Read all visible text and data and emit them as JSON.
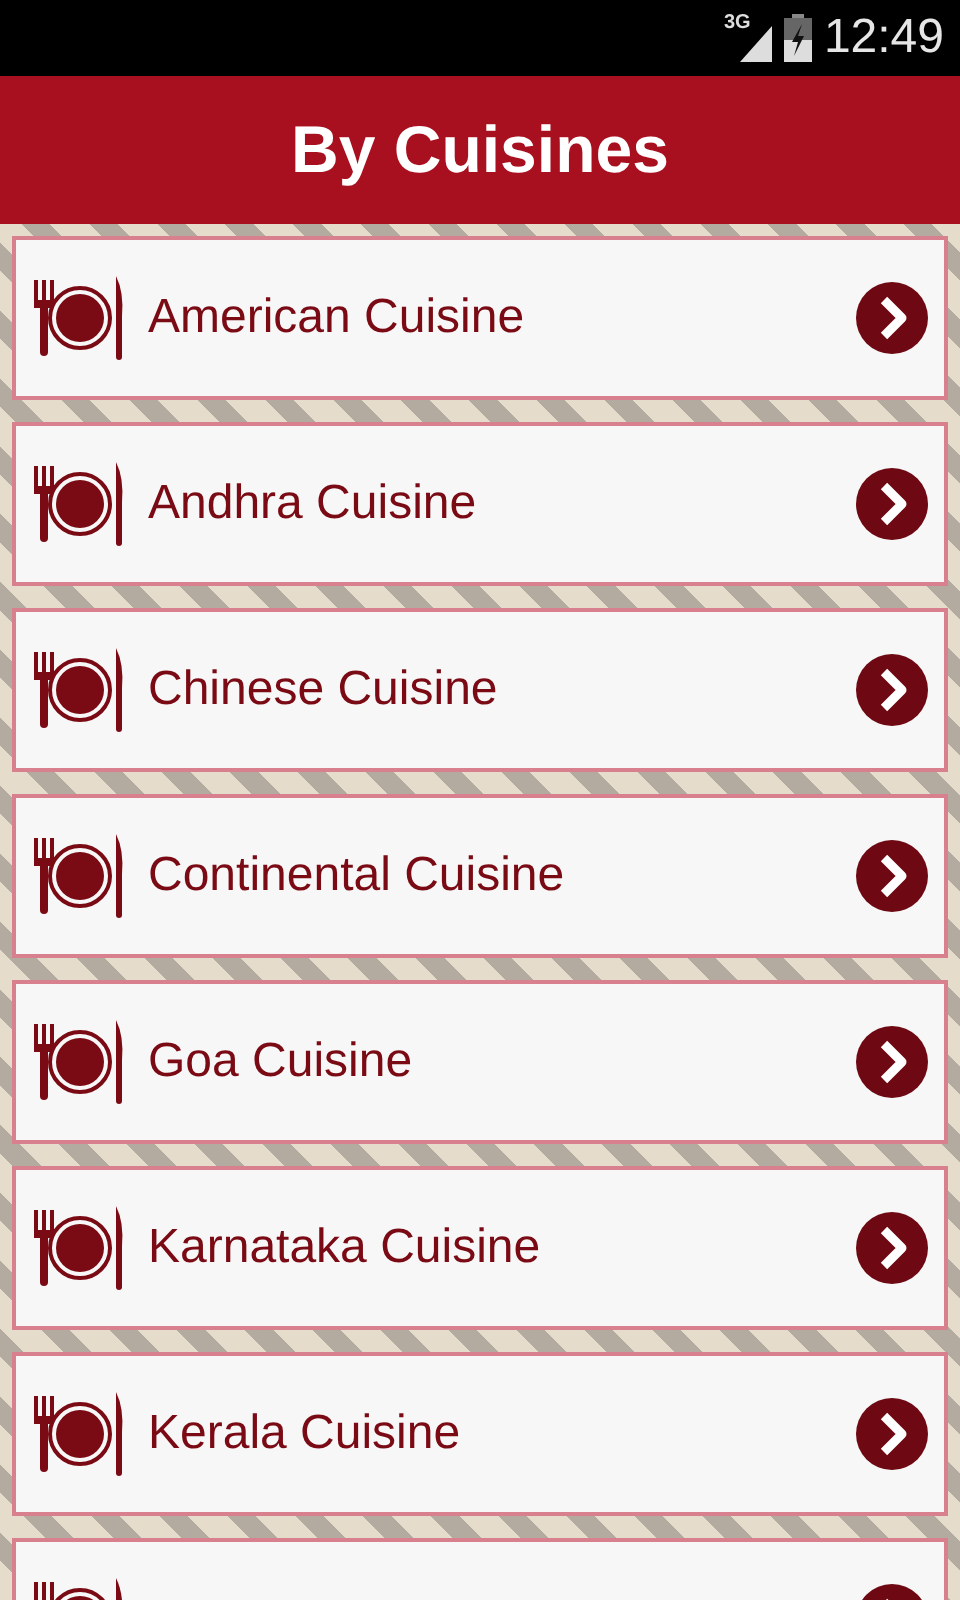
{
  "status_bar": {
    "network": "3G",
    "time": "12:49"
  },
  "header": {
    "title": "By Cuisines"
  },
  "items": [
    {
      "kind": "row",
      "label": "American Cuisine"
    },
    {
      "kind": "row",
      "label": "Andhra Cuisine"
    },
    {
      "kind": "row",
      "label": "Chinese Cuisine"
    },
    {
      "kind": "row",
      "label": "Continental Cuisine"
    },
    {
      "kind": "row",
      "label": "Goa Cuisine"
    },
    {
      "kind": "row",
      "label": "Karnataka Cuisine"
    },
    {
      "kind": "row",
      "label": "Kerala Cuisine"
    },
    {
      "kind": "cut-off"
    }
  ]
}
